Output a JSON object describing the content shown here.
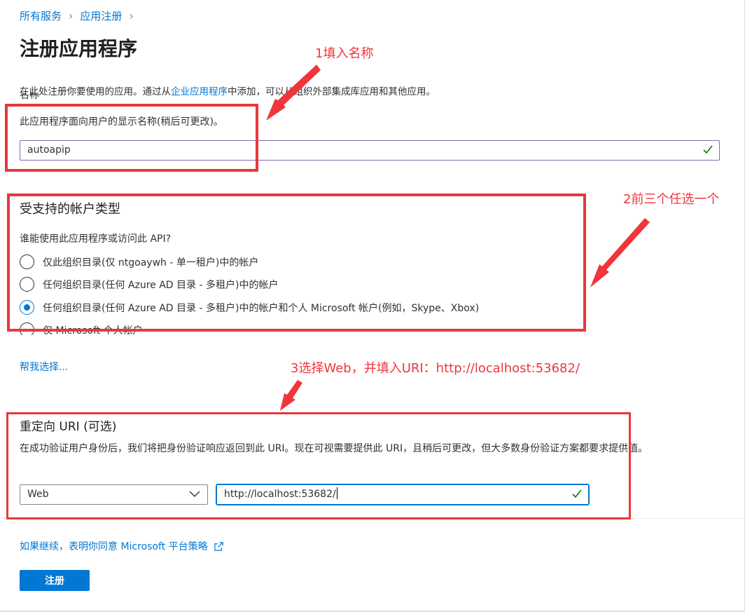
{
  "breadcrumb": {
    "item1": "所有服务",
    "item2": "应用注册"
  },
  "page_title": "注册应用程序",
  "intro": {
    "prefix": "在此处注册你要使用的应用。通过从",
    "link": "企业应用程序",
    "suffix": "中添加，可以从组织外部集成库应用和其他应用。"
  },
  "name_section": {
    "label": "名称",
    "description": "此应用程序面向用户的显示名称(稍后可更改)。",
    "value": "autoapip"
  },
  "account_types": {
    "heading": "受支持的帐户类型",
    "question": "谁能使用此应用程序或访问此 API?",
    "options": [
      {
        "label": "仅此组织目录(仅 ntgoaywh - 单一租户)中的帐户",
        "selected": false
      },
      {
        "label": "任何组织目录(任何 Azure AD 目录 - 多租户)中的帐户",
        "selected": false
      },
      {
        "label": "任何组织目录(任何 Azure AD 目录 - 多租户)中的帐户和个人 Microsoft 帐户(例如，Skype、Xbox)",
        "selected": true
      },
      {
        "label": "仅 Microsoft 个人帐户",
        "selected": false
      }
    ],
    "help_link": "帮我选择..."
  },
  "redirect": {
    "heading": "重定向 URI (可选)",
    "description": "在成功验证用户身份后，我们将把身份验证响应返回到此 URI。现在可视需要提供此 URI，且稍后可更改，但大多数身份验证方案都要求提供值。",
    "platform": "Web",
    "uri": "http://localhost:53682/"
  },
  "policy_link": "如果继续，表明你同意 Microsoft 平台策略",
  "register_button": "注册",
  "annotations": {
    "note1": "1填入名称",
    "note2": "2前三个任选一个",
    "note3": "3选择Web，并填入URI：http://localhost:53682/"
  },
  "colors": {
    "accent": "#0078d4",
    "annotation_red": "#e8383d",
    "valid_check": "#107c10"
  },
  "icons": [
    "chevron-right-icon",
    "checkmark-icon",
    "chevron-down-icon",
    "external-link-icon",
    "arrow-annotation"
  ]
}
